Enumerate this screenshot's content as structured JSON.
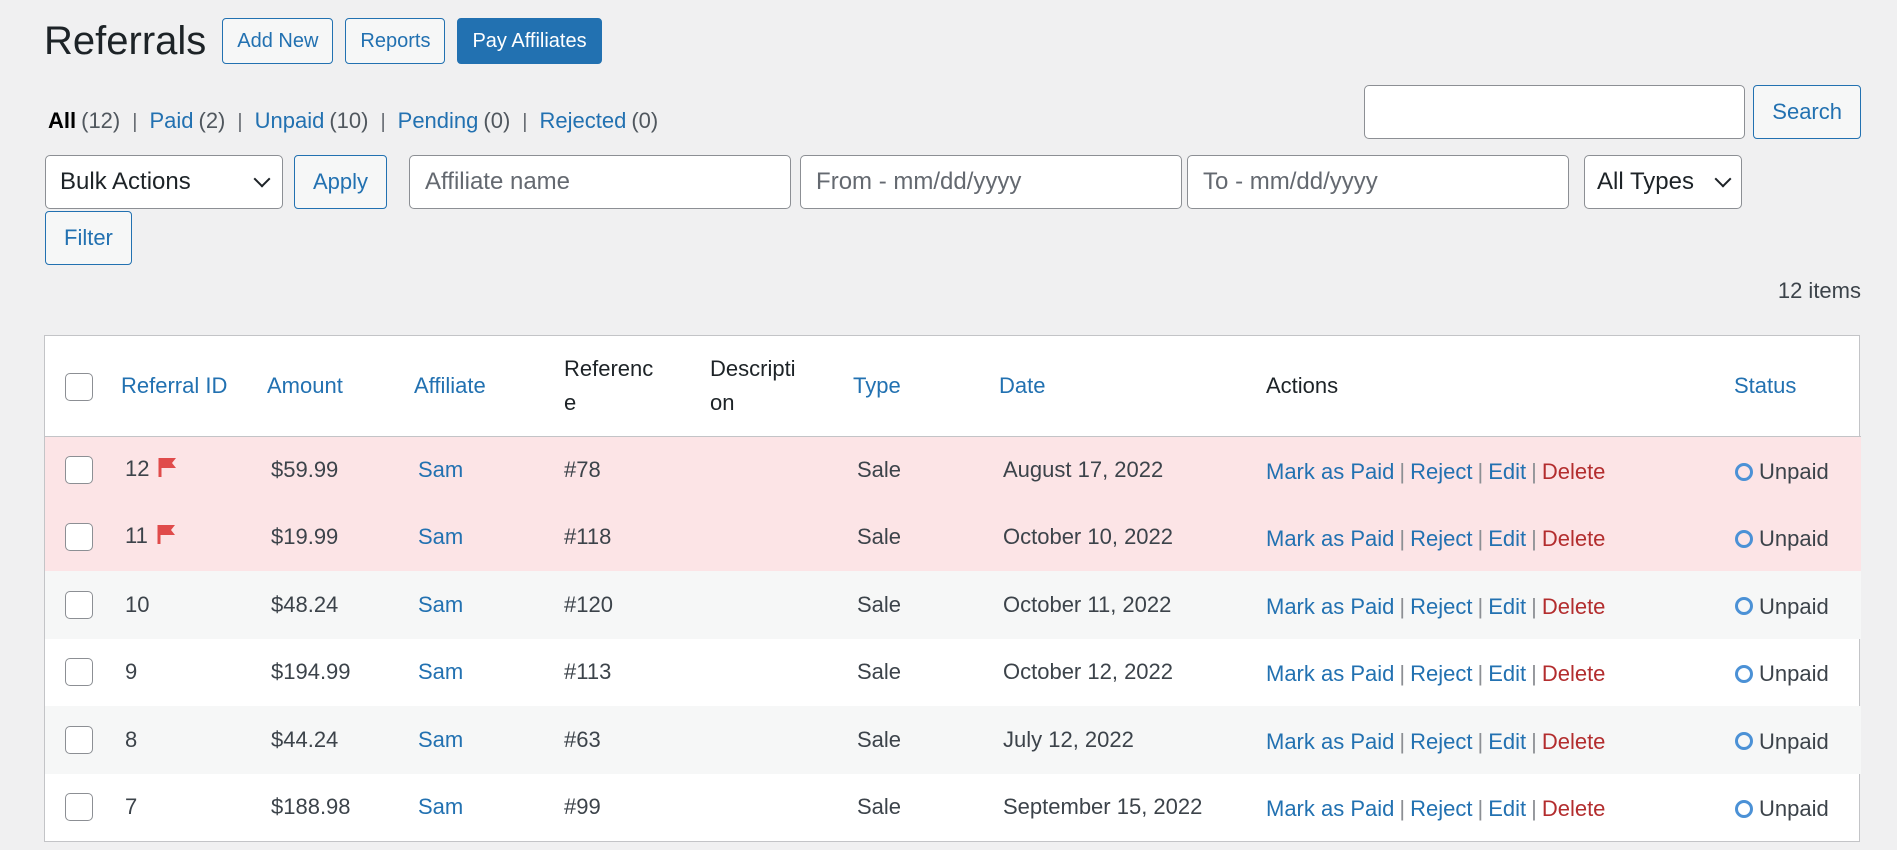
{
  "header": {
    "title": "Referrals",
    "add_new": "Add New",
    "reports": "Reports",
    "pay_affiliates": "Pay Affiliates"
  },
  "views": [
    {
      "label": "All",
      "count": "(12)",
      "current": true
    },
    {
      "label": "Paid",
      "count": "(2)",
      "current": false
    },
    {
      "label": "Unpaid",
      "count": "(10)",
      "current": false
    },
    {
      "label": "Pending",
      "count": "(0)",
      "current": false
    },
    {
      "label": "Rejected",
      "count": "(0)",
      "current": false
    }
  ],
  "search": {
    "value": "",
    "button": "Search"
  },
  "filters": {
    "bulk_actions": "Bulk Actions",
    "apply": "Apply",
    "affiliate_placeholder": "Affiliate name",
    "from_placeholder": "From - mm/dd/yyyy",
    "to_placeholder": "To - mm/dd/yyyy",
    "types": "All Types",
    "filter": "Filter"
  },
  "items_count": "12 items",
  "table": {
    "columns": {
      "id": "Referral ID",
      "amount": "Amount",
      "affiliate": "Affiliate",
      "reference_1": "Referenc",
      "reference_2": "e",
      "description_1": "Descripti",
      "description_2": "on",
      "type": "Type",
      "date": "Date",
      "actions": "Actions",
      "status": "Status"
    },
    "action_labels": {
      "mark_paid": "Mark as Paid",
      "reject": "Reject",
      "edit": "Edit",
      "delete": "Delete",
      "sep": "|"
    },
    "rows": [
      {
        "id": "12",
        "flagged": true,
        "amount": "$59.99",
        "affiliate": "Sam",
        "reference": "#78",
        "description": "",
        "type": "Sale",
        "date": "August 17, 2022",
        "status": "Unpaid"
      },
      {
        "id": "11",
        "flagged": true,
        "amount": "$19.99",
        "affiliate": "Sam",
        "reference": "#118",
        "description": "",
        "type": "Sale",
        "date": "October 10, 2022",
        "status": "Unpaid"
      },
      {
        "id": "10",
        "flagged": false,
        "amount": "$48.24",
        "affiliate": "Sam",
        "reference": "#120",
        "description": "",
        "type": "Sale",
        "date": "October 11, 2022",
        "status": "Unpaid"
      },
      {
        "id": "9",
        "flagged": false,
        "amount": "$194.99",
        "affiliate": "Sam",
        "reference": "#113",
        "description": "",
        "type": "Sale",
        "date": "October 12, 2022",
        "status": "Unpaid"
      },
      {
        "id": "8",
        "flagged": false,
        "amount": "$44.24",
        "affiliate": "Sam",
        "reference": "#63",
        "description": "",
        "type": "Sale",
        "date": "July 12, 2022",
        "status": "Unpaid"
      },
      {
        "id": "7",
        "flagged": false,
        "amount": "$188.98",
        "affiliate": "Sam",
        "reference": "#99",
        "description": "",
        "type": "Sale",
        "date": "September 15, 2022",
        "status": "Unpaid"
      }
    ]
  },
  "colors": {
    "link": "#2271b1",
    "delete": "#b32d2e",
    "flagged_row": "#fce4e6",
    "flag": "#e04b4b"
  }
}
